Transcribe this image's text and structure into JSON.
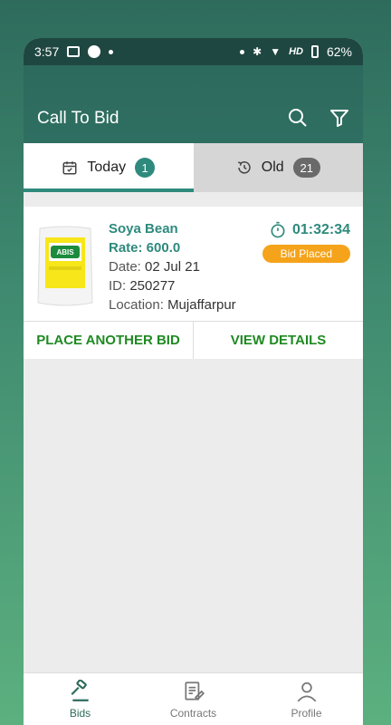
{
  "status_bar": {
    "time": "3:57",
    "network": "HD",
    "battery": "62%"
  },
  "appbar": {
    "title": "Call To Bid",
    "icons": [
      "search-icon",
      "filter-icon"
    ]
  },
  "tabs": [
    {
      "label": "Today",
      "count": "1",
      "icon": "calendar-icon"
    },
    {
      "label": "Old",
      "count": "21",
      "icon": "history-icon"
    }
  ],
  "bid_card": {
    "product_name": "Soya Bean",
    "rate": "Rate: 600.0",
    "date_label": "Date:",
    "date_value": "02 Jul 21",
    "id_label": "ID:",
    "id_value": "250277",
    "location_label": "Location:",
    "location_value": "Mujaffarpur",
    "timer": "01:32:34",
    "status": "Bid Placed",
    "product_brand": "ABIS",
    "actions": {
      "place_bid": "PLACE ANOTHER BID",
      "view_details": "VIEW DETAILS"
    }
  },
  "bottom_nav": [
    {
      "label": "Bids",
      "icon": "gavel-icon"
    },
    {
      "label": "Contracts",
      "icon": "contract-icon"
    },
    {
      "label": "Profile",
      "icon": "profile-icon"
    }
  ],
  "colors": {
    "primary": "#2e8a7c",
    "accent": "#f5a31a",
    "action": "#1f8a22"
  }
}
